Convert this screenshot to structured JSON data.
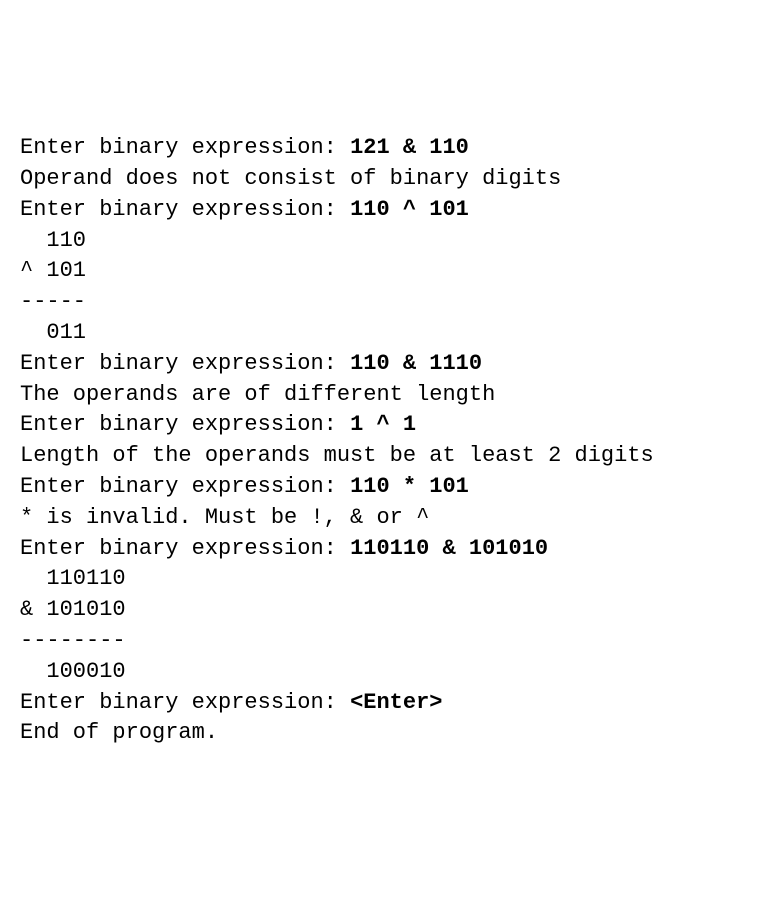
{
  "lines": [
    {
      "parts": [
        {
          "text": "Enter binary expression: ",
          "bold": false
        },
        {
          "text": "121 & 110",
          "bold": true
        }
      ]
    },
    {
      "parts": [
        {
          "text": "Operand does not consist of binary digits",
          "bold": false
        }
      ]
    },
    {
      "parts": [
        {
          "text": "Enter binary expression: ",
          "bold": false
        },
        {
          "text": "110 ^ 101",
          "bold": true
        }
      ]
    },
    {
      "parts": [
        {
          "text": "  110",
          "bold": false
        }
      ]
    },
    {
      "parts": [
        {
          "text": "^ 101",
          "bold": false
        }
      ]
    },
    {
      "parts": [
        {
          "text": "-----",
          "bold": false
        }
      ]
    },
    {
      "parts": [
        {
          "text": "  011",
          "bold": false
        }
      ]
    },
    {
      "parts": [
        {
          "text": "Enter binary expression: ",
          "bold": false
        },
        {
          "text": "110 & 1110",
          "bold": true
        }
      ]
    },
    {
      "parts": [
        {
          "text": "The operands are of different length",
          "bold": false
        }
      ]
    },
    {
      "parts": [
        {
          "text": "Enter binary expression: ",
          "bold": false
        },
        {
          "text": "1 ^ 1",
          "bold": true
        }
      ]
    },
    {
      "parts": [
        {
          "text": "Length of the operands must be at least 2 digits",
          "bold": false
        }
      ]
    },
    {
      "parts": [
        {
          "text": "Enter binary expression: ",
          "bold": false
        },
        {
          "text": "110 * 101",
          "bold": true
        }
      ]
    },
    {
      "parts": [
        {
          "text": "* is invalid. Must be !, & or ^",
          "bold": false
        }
      ]
    },
    {
      "parts": [
        {
          "text": "Enter binary expression: ",
          "bold": false
        },
        {
          "text": "110110 & 101010",
          "bold": true
        }
      ]
    },
    {
      "parts": [
        {
          "text": "  110110",
          "bold": false
        }
      ]
    },
    {
      "parts": [
        {
          "text": "& 101010",
          "bold": false
        }
      ]
    },
    {
      "parts": [
        {
          "text": "--------",
          "bold": false
        }
      ]
    },
    {
      "parts": [
        {
          "text": "  100010",
          "bold": false
        }
      ]
    },
    {
      "parts": [
        {
          "text": "Enter binary expression: ",
          "bold": false
        },
        {
          "text": "<Enter>",
          "bold": true
        }
      ]
    },
    {
      "parts": [
        {
          "text": "End of program.",
          "bold": false
        }
      ]
    }
  ]
}
